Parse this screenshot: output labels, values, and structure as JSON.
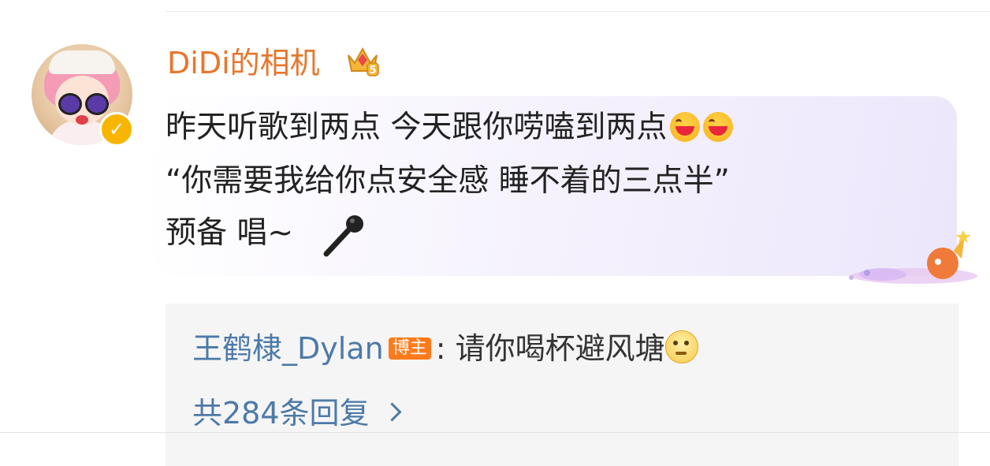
{
  "post": {
    "username": "DiDi的相机",
    "comment_lines": [
      "昨天听歌到两点 今天跟你唠嗑到两点",
      "“你需要我给你点安全感 睡不着的三点半”",
      "预备 唱~"
    ]
  },
  "reply": {
    "author": "王鹤棣_Dylan",
    "badge": "博主",
    "separator": ":",
    "text": "请你喝杯避风塘",
    "count_label": "共284条回复"
  },
  "icons": {
    "avatar": "anime-girl-avatar",
    "verified": "verified-v-icon",
    "crown": "crown-level-5-icon",
    "emoji_grin": "grinning-emoji",
    "mic": "microphone-icon",
    "think": "thinking-emoji",
    "chevron": "chevron-right-icon"
  },
  "colors": {
    "username": "#e8762c",
    "link": "#4d7aa8",
    "badge": "#ff7a1a",
    "verified": "#f7b500"
  }
}
